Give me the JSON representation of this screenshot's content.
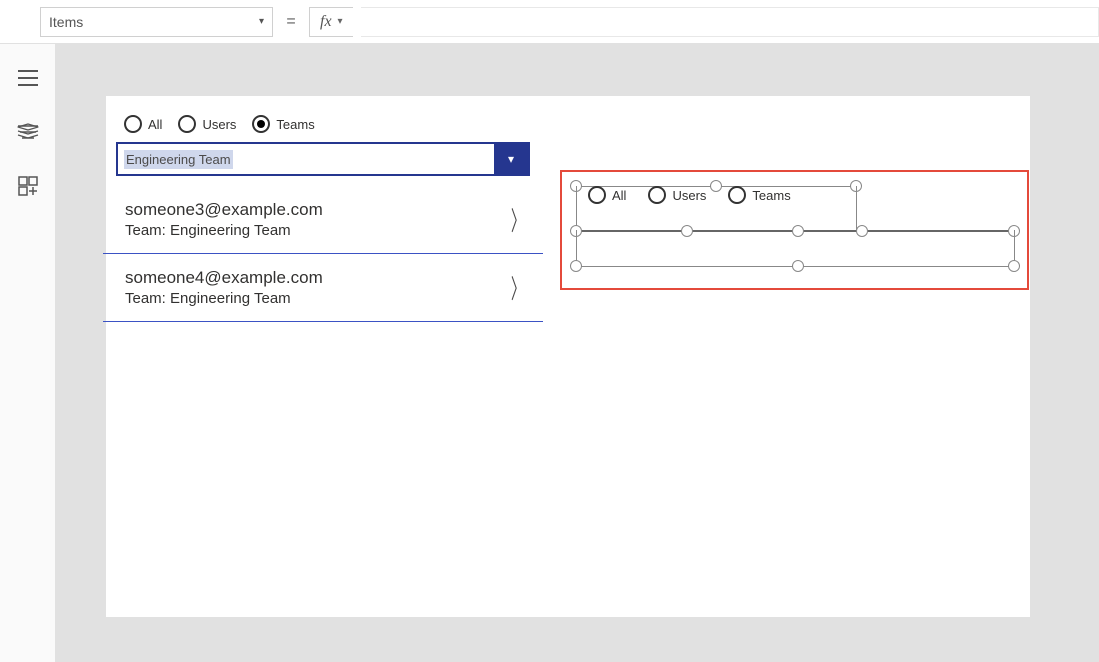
{
  "formula_bar": {
    "property": "Items",
    "equals": "=",
    "fx_label": "fx"
  },
  "left_rail": {
    "menu_title": "menu",
    "tree_title": "tree",
    "insert_title": "insert"
  },
  "screen": {
    "filter_radio": {
      "all": "All",
      "users": "Users",
      "teams": "Teams",
      "selected": "teams"
    },
    "dropdown": {
      "value": "Engineering Team"
    },
    "list": [
      {
        "primary": "someone3@example.com",
        "secondary": "Team: Engineering Team"
      },
      {
        "primary": "someone4@example.com",
        "secondary": "Team: Engineering Team"
      }
    ],
    "design_copy_radio": {
      "all": "All",
      "users": "Users",
      "teams": "Teams"
    }
  }
}
